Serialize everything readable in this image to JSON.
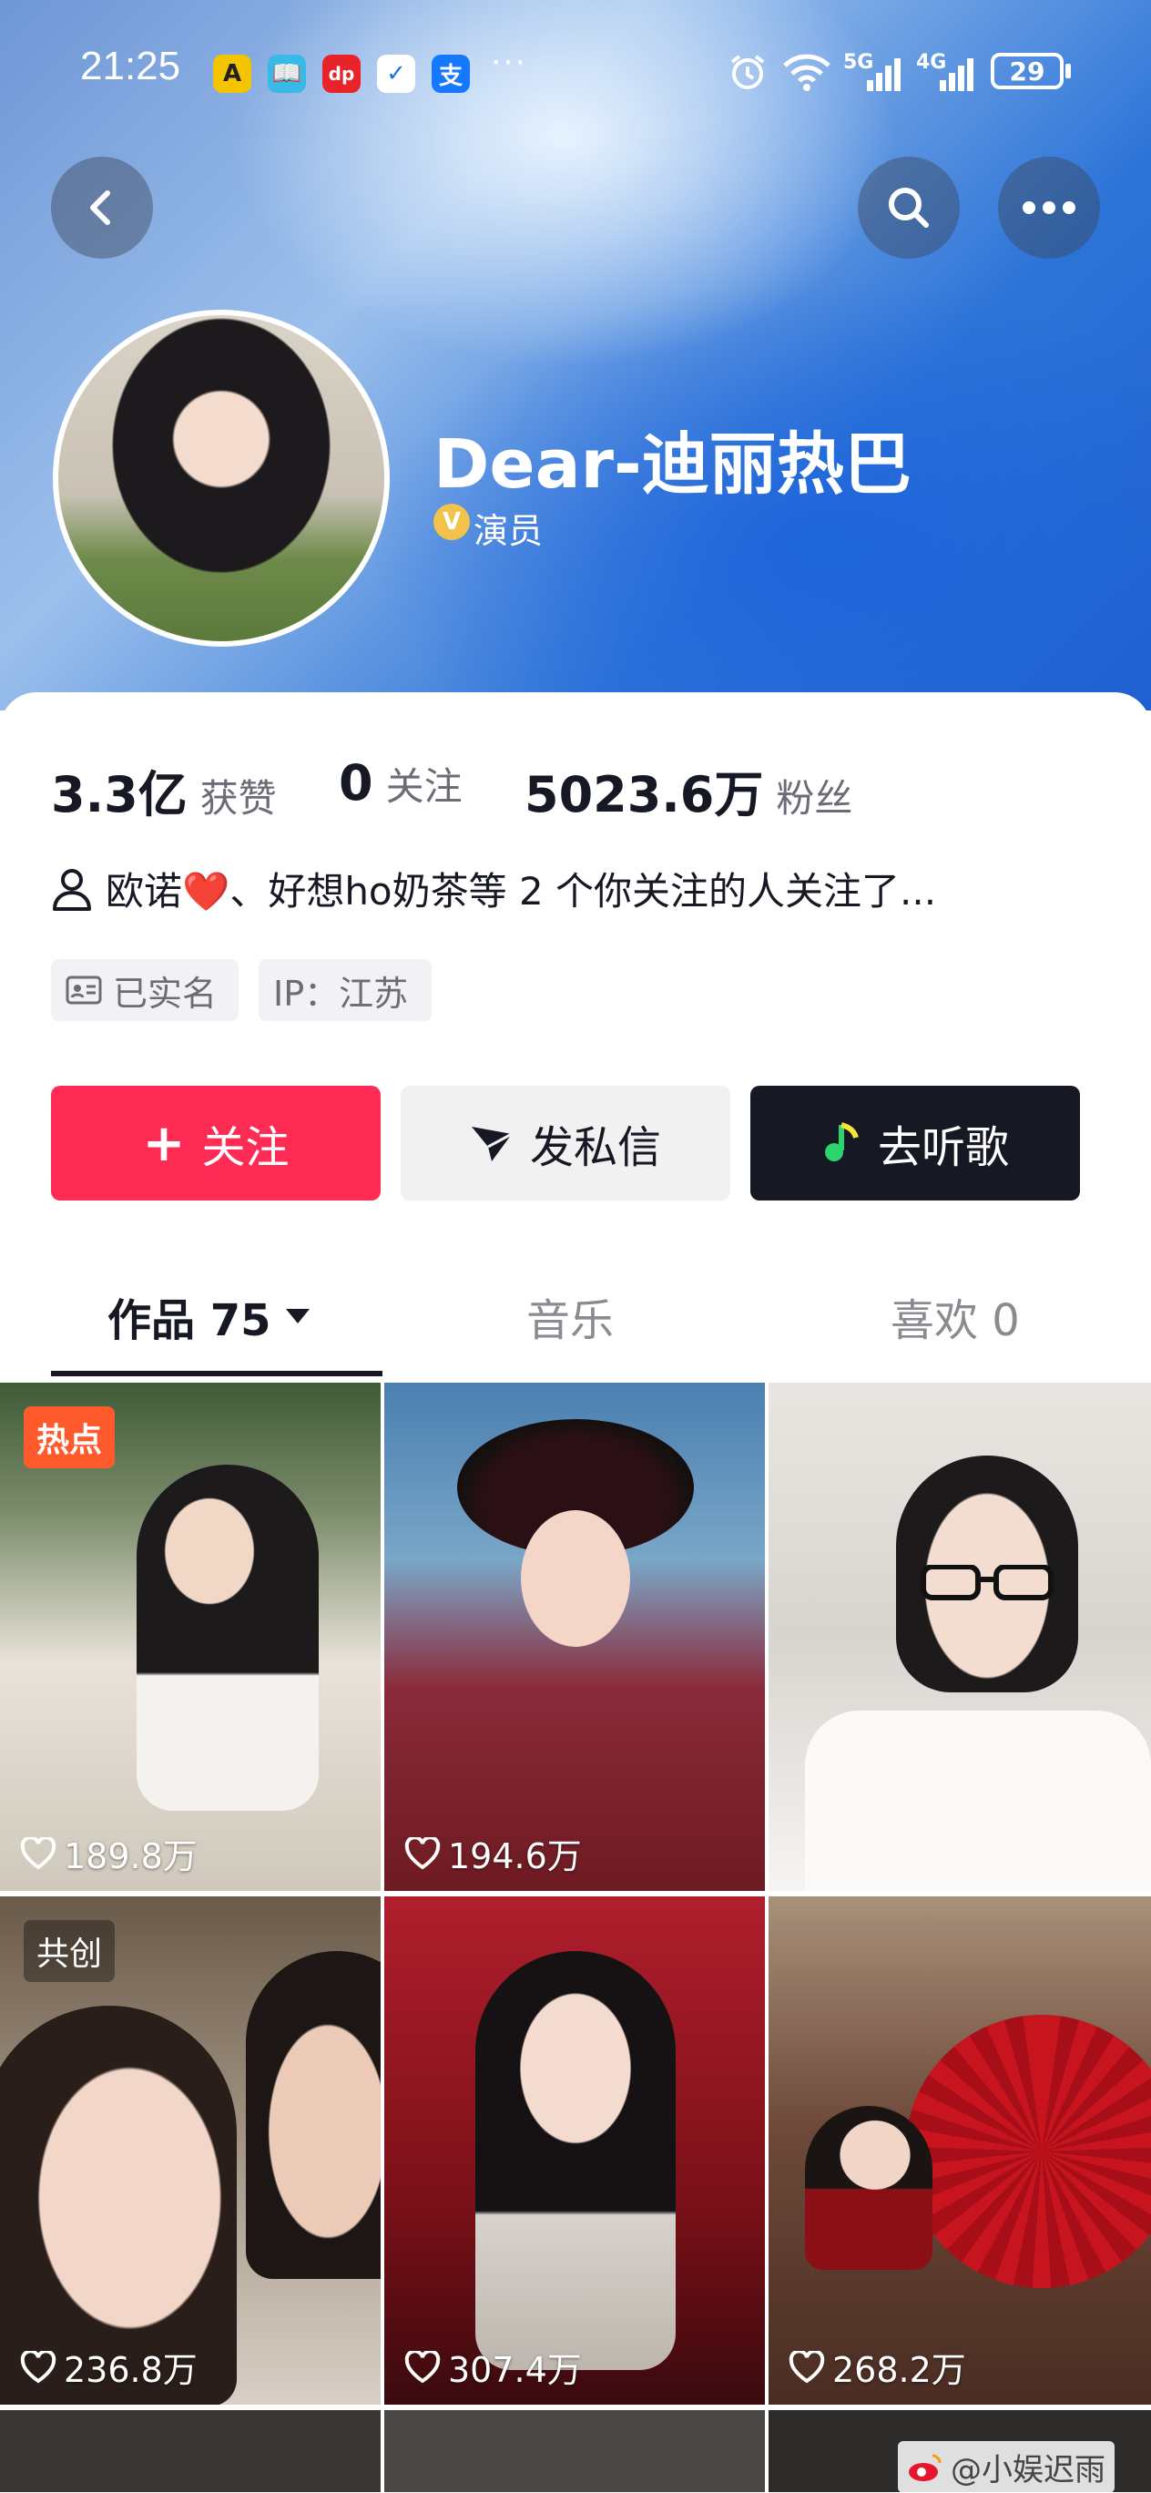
{
  "status_bar": {
    "time": "21:25",
    "apps": [
      "A",
      "📖",
      "dp",
      "✓",
      "支"
    ],
    "more": "···",
    "network1": "5G",
    "network2": "4G",
    "battery": "29"
  },
  "nav": {
    "back_icon": "back-chevron-icon",
    "search_icon": "search-icon",
    "more_icon": "more-dots-icon"
  },
  "profile": {
    "name": "Dear-迪丽热巴",
    "verified_badge": "V",
    "role": "演员"
  },
  "stats": {
    "likes_value": "3.3亿",
    "likes_label": "获赞",
    "following_value": "0",
    "following_label": "关注",
    "followers_value": "5023.6万",
    "followers_label": "粉丝"
  },
  "mutual": {
    "text_prefix": "欧诺",
    "heart": "❤️",
    "text_suffix": "、好想ho奶茶等 2 个你关注的人关注了..."
  },
  "chips": {
    "real_name": "已实名",
    "ip": "IP：江苏"
  },
  "actions": {
    "follow": "关注",
    "follow_icon": "+",
    "message": "发私信",
    "music": "去听歌"
  },
  "tabs": {
    "works": "作品 75",
    "music": "音乐",
    "likes": "喜欢 0"
  },
  "videos": [
    {
      "likes": "189.8万",
      "tag": "热点"
    },
    {
      "likes": "194.6万",
      "tag": ""
    },
    {
      "likes": "",
      "tag": ""
    },
    {
      "likes": "236.8万",
      "tag": "共创"
    },
    {
      "likes": "307.4万",
      "tag": ""
    },
    {
      "likes": "268.2万",
      "tag": ""
    }
  ],
  "watermark": "@小娱迟雨",
  "colors": {
    "follow_red": "#fe2c55",
    "music_dark": "#161823",
    "message_gray": "#f1f1f2"
  }
}
